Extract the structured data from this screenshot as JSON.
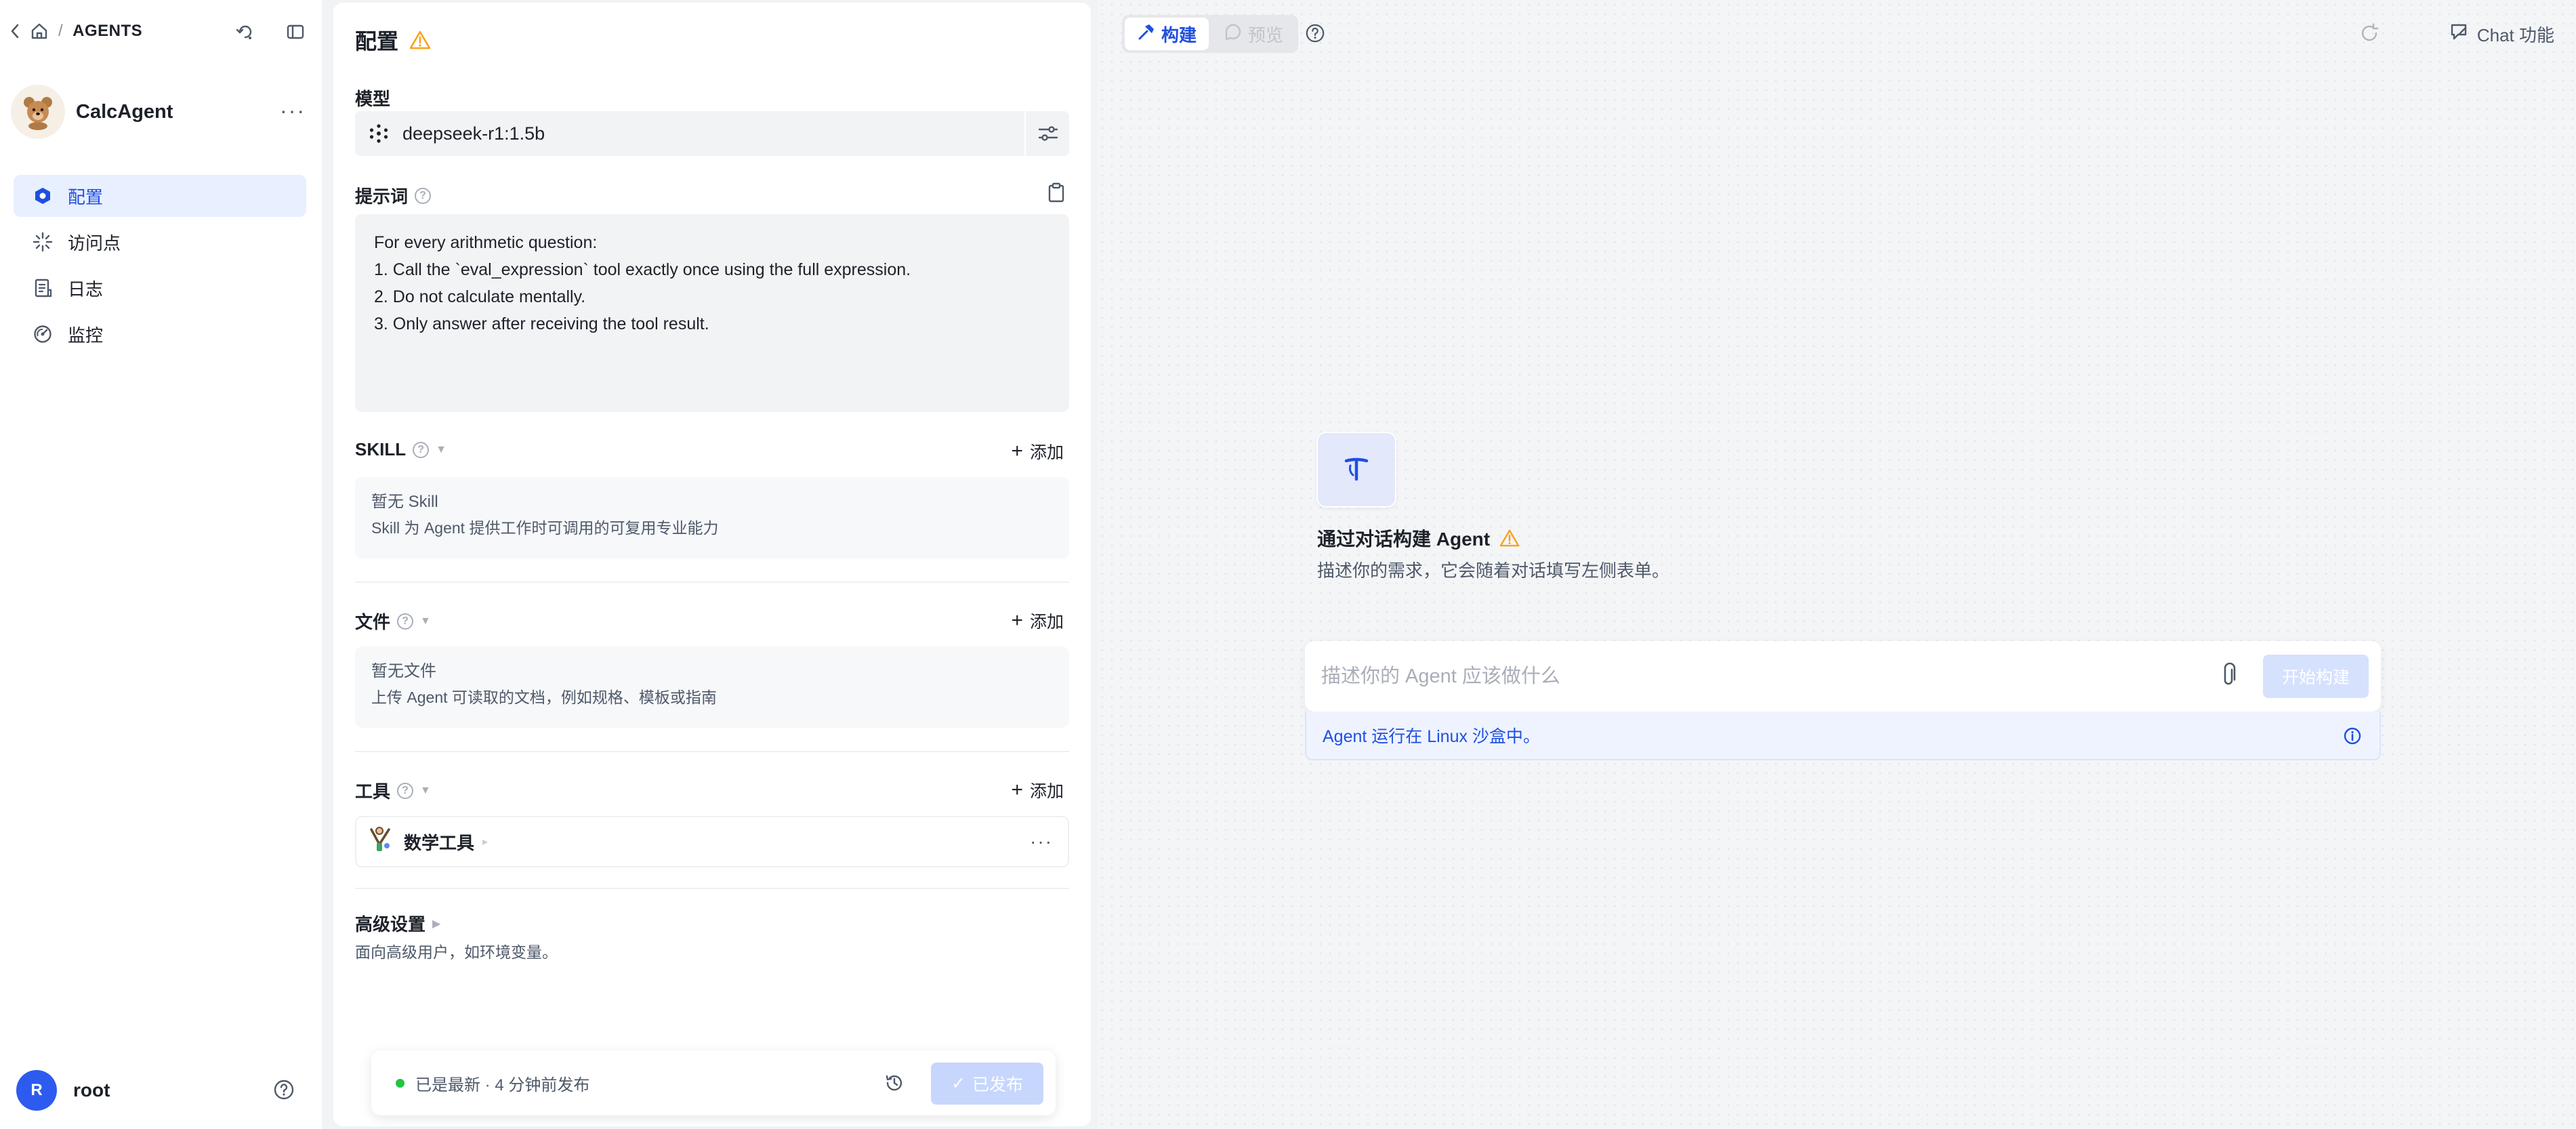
{
  "breadcrumb": {
    "root_label": "AGENTS"
  },
  "agent": {
    "name": "CalcAgent"
  },
  "nav": {
    "items": [
      {
        "label": "配置",
        "icon": "config-icon",
        "active": true
      },
      {
        "label": "访问点",
        "icon": "access-point-icon",
        "active": false
      },
      {
        "label": "日志",
        "icon": "log-icon",
        "active": false
      },
      {
        "label": "监控",
        "icon": "monitor-icon",
        "active": false
      }
    ]
  },
  "user": {
    "initial": "R",
    "name": "root"
  },
  "config": {
    "title": "配置",
    "model_label": "模型",
    "model_value": "deepseek-r1:1.5b",
    "prompt_label": "提示词",
    "prompt_lines": [
      "For every arithmetic question:",
      "1. Call the `eval_expression` tool exactly once using the full expression.",
      "2. Do not calculate mentally.",
      "3. Only answer after receiving the tool result."
    ],
    "skill": {
      "label": "SKILL",
      "add_label": "添加",
      "empty_title": "暂无 Skill",
      "empty_desc": "Skill 为 Agent 提供工作时可调用的可复用专业能力"
    },
    "files": {
      "label": "文件",
      "add_label": "添加",
      "empty_title": "暂无文件",
      "empty_desc": "上传 Agent 可读取的文档，例如规格、模板或指南"
    },
    "tools": {
      "label": "工具",
      "add_label": "添加",
      "items": [
        {
          "name": "数学工具"
        }
      ]
    },
    "advanced": {
      "title": "高级设置",
      "desc": "面向高级用户，如环境变量。"
    },
    "status": {
      "text": "已是最新 · 4 分钟前发布",
      "publish_label": "已发布"
    }
  },
  "canvas": {
    "tabs": [
      {
        "label": "构建",
        "active": true
      },
      {
        "label": "预览",
        "active": false
      }
    ],
    "chat_func_label": "Chat 功能",
    "hero_title": "通过对话构建 Agent",
    "hero_desc": "描述你的需求，它会随着对话填写左侧表单。",
    "input_placeholder": "描述你的 Agent 应该做什么",
    "build_label": "开始构建",
    "info_text": "Agent 运行在 Linux 沙盒中。"
  },
  "colors": {
    "accent": "#1f4fe0",
    "warning": "#f7a21b",
    "status_ok": "#23c343",
    "avatar": "#2d5bf0"
  }
}
